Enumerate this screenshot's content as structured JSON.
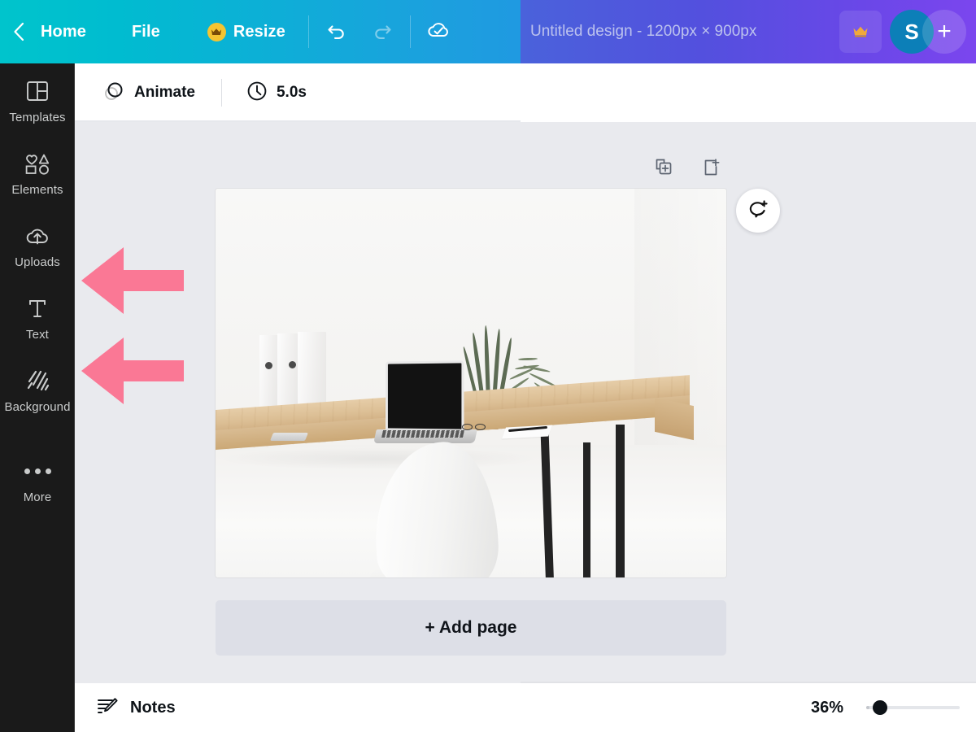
{
  "topbar": {
    "back_icon": "chevron-left-icon",
    "home_label": "Home",
    "file_label": "File",
    "resize_label": "Resize",
    "resize_badge_icon": "crown-icon",
    "undo_icon": "undo-icon",
    "redo_icon": "redo-icon",
    "saved_icon": "cloud-check-icon",
    "colors": {
      "gradient_start": "#00C4CC",
      "gradient_end": "#23A3E0",
      "overlay_start": "#4A62DB",
      "overlay_end": "#7B46EE"
    }
  },
  "share_panel": {
    "document_title": "Untitled design - 1200px × 900px",
    "pro_icon": "crown-icon",
    "avatar_initial": "S",
    "avatar_color": "#0C7FB8",
    "add_collaborator_label": "+"
  },
  "sidebar": {
    "items": [
      {
        "label": "Templates",
        "icon": "templates-icon"
      },
      {
        "label": "Elements",
        "icon": "elements-icon"
      },
      {
        "label": "Uploads",
        "icon": "cloud-upload-icon"
      },
      {
        "label": "Text",
        "icon": "text-t-icon"
      },
      {
        "label": "Background",
        "icon": "hatch-background-icon"
      },
      {
        "label": "More",
        "icon": "ellipsis-icon"
      }
    ],
    "background_color": "#1A1A1A"
  },
  "toolbar": {
    "animate_label": "Animate",
    "animate_icon": "animate-circles-icon",
    "duration_label": "5.0s",
    "duration_icon": "clock-icon"
  },
  "canvas": {
    "background_color": "#E9EAEE",
    "duplicate_page_icon": "duplicate-page-icon",
    "add_page_icon": "add-page-icon",
    "comment_icon": "add-comment-icon",
    "add_page_label": "+ Add page",
    "page_image_alt": "Minimalist wooden desk with laptop, plants, binders and white chair"
  },
  "bottombar": {
    "notes_label": "Notes",
    "notes_icon": "notes-pencil-icon",
    "zoom_level": "36%",
    "zoom_slider_value": 8
  },
  "annotations": {
    "color": "#FA7895",
    "arrows": [
      {
        "name": "arrow-pointing-uploads",
        "target": "Uploads",
        "direction": "left"
      },
      {
        "name": "arrow-pointing-text",
        "target": "Text",
        "direction": "left"
      }
    ]
  }
}
